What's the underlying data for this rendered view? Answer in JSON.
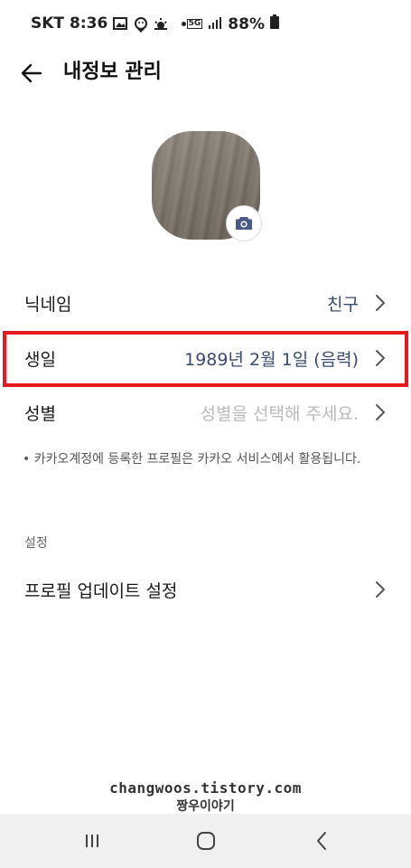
{
  "status_bar": {
    "carrier": "SKT",
    "time": "8:36",
    "network": "5G",
    "battery": "88%"
  },
  "header": {
    "title": "내정보 관리"
  },
  "profile": {
    "camera_icon": "camera-icon"
  },
  "rows": {
    "nickname": {
      "label": "닉네임",
      "value": "친구"
    },
    "birthday": {
      "label": "생일",
      "value": "1989년 2월 1일 (음력)"
    },
    "gender": {
      "label": "성별",
      "value": "성별을 선택해 주세요."
    }
  },
  "notice": {
    "text": "• 카카오계정에 등록한 프로필은 카카오 서비스에서 활용됩니다."
  },
  "settings": {
    "section_label": "설정",
    "profile_update_label": "프로필 업데이트 설정"
  },
  "watermark": {
    "line1": "changwoos.tistory.com",
    "line2": "짱우이야기"
  },
  "colors": {
    "highlight": "#e8171c",
    "value_text": "#3a4a6b",
    "placeholder_text": "#b9b9b9"
  }
}
